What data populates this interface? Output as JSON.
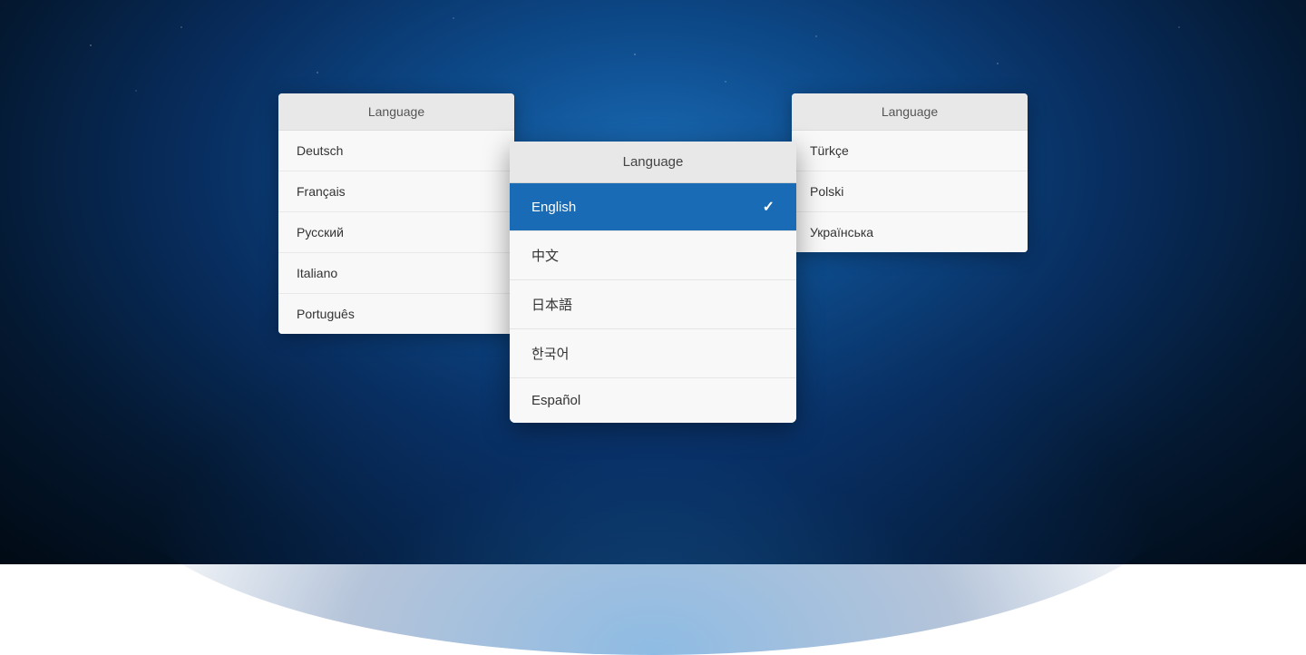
{
  "background": {
    "description": "Earth from space, blue atmosphere"
  },
  "left_panel": {
    "header": "Language",
    "items": [
      {
        "label": "Deutsch"
      },
      {
        "label": "Français"
      },
      {
        "label": "Русский"
      },
      {
        "label": "Italiano"
      },
      {
        "label": "Português"
      }
    ]
  },
  "right_panel": {
    "header": "Language",
    "items": [
      {
        "label": "Türkçe"
      },
      {
        "label": "Polski"
      },
      {
        "label": "Українська"
      }
    ]
  },
  "dropdown": {
    "header": "Language",
    "items": [
      {
        "label": "English",
        "selected": true
      },
      {
        "label": "中文",
        "selected": false
      },
      {
        "label": "日本語",
        "selected": false
      },
      {
        "label": "한국어",
        "selected": false
      },
      {
        "label": "Español",
        "selected": false
      }
    ],
    "checkmark": "✓"
  }
}
